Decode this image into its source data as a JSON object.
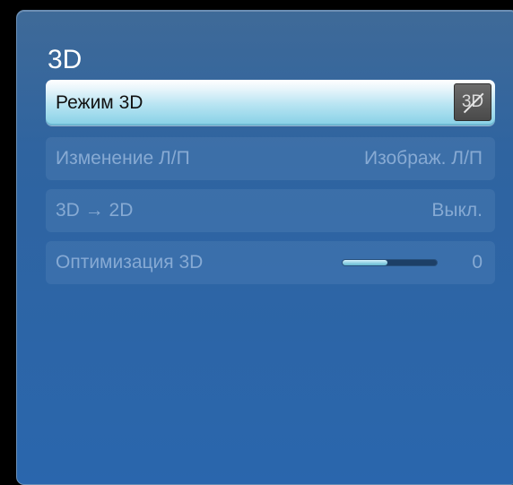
{
  "menu": {
    "title": "3D",
    "items": [
      {
        "label": "Режим 3D",
        "icon_text": "3D",
        "icon": "3d-off-icon",
        "selected": true,
        "enabled": true
      },
      {
        "label": "Изменение Л/П",
        "value": "Изображ. Л/П",
        "enabled": false
      },
      {
        "label": "3D → 2D",
        "value": "Выкл.",
        "enabled": false
      },
      {
        "label": "Оптимизация 3D",
        "value": "0",
        "slider_fraction": 0.48,
        "enabled": false
      }
    ]
  },
  "colors": {
    "panel_bg": "#2a66ad",
    "selected_highlight": "#b7e4f2",
    "disabled_text": "#a0bee1",
    "slider_fill": "#8ccfe2",
    "slider_track": "#1d3f66"
  }
}
